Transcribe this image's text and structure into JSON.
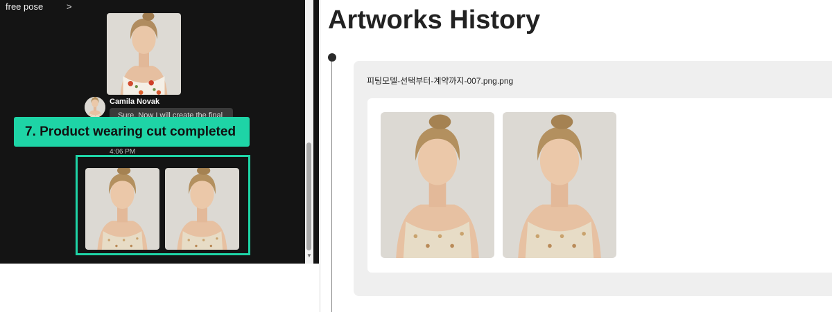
{
  "chat": {
    "top_label": "free pose",
    "top_chevron": ">",
    "sender_name": "Camila Novak",
    "message_preview": "Sure. Now I will create the final",
    "callout": "7. Product wearing cut completed",
    "timestamp": "4:06 PM",
    "scroll_down_arrow": "▼"
  },
  "history": {
    "title": "Artworks History",
    "filename": "피팅모델-선택부터-계약까지-007.png.png"
  },
  "colors": {
    "accent": "#1ed4a6",
    "chat_background": "#141414",
    "card_background": "#efefef"
  }
}
